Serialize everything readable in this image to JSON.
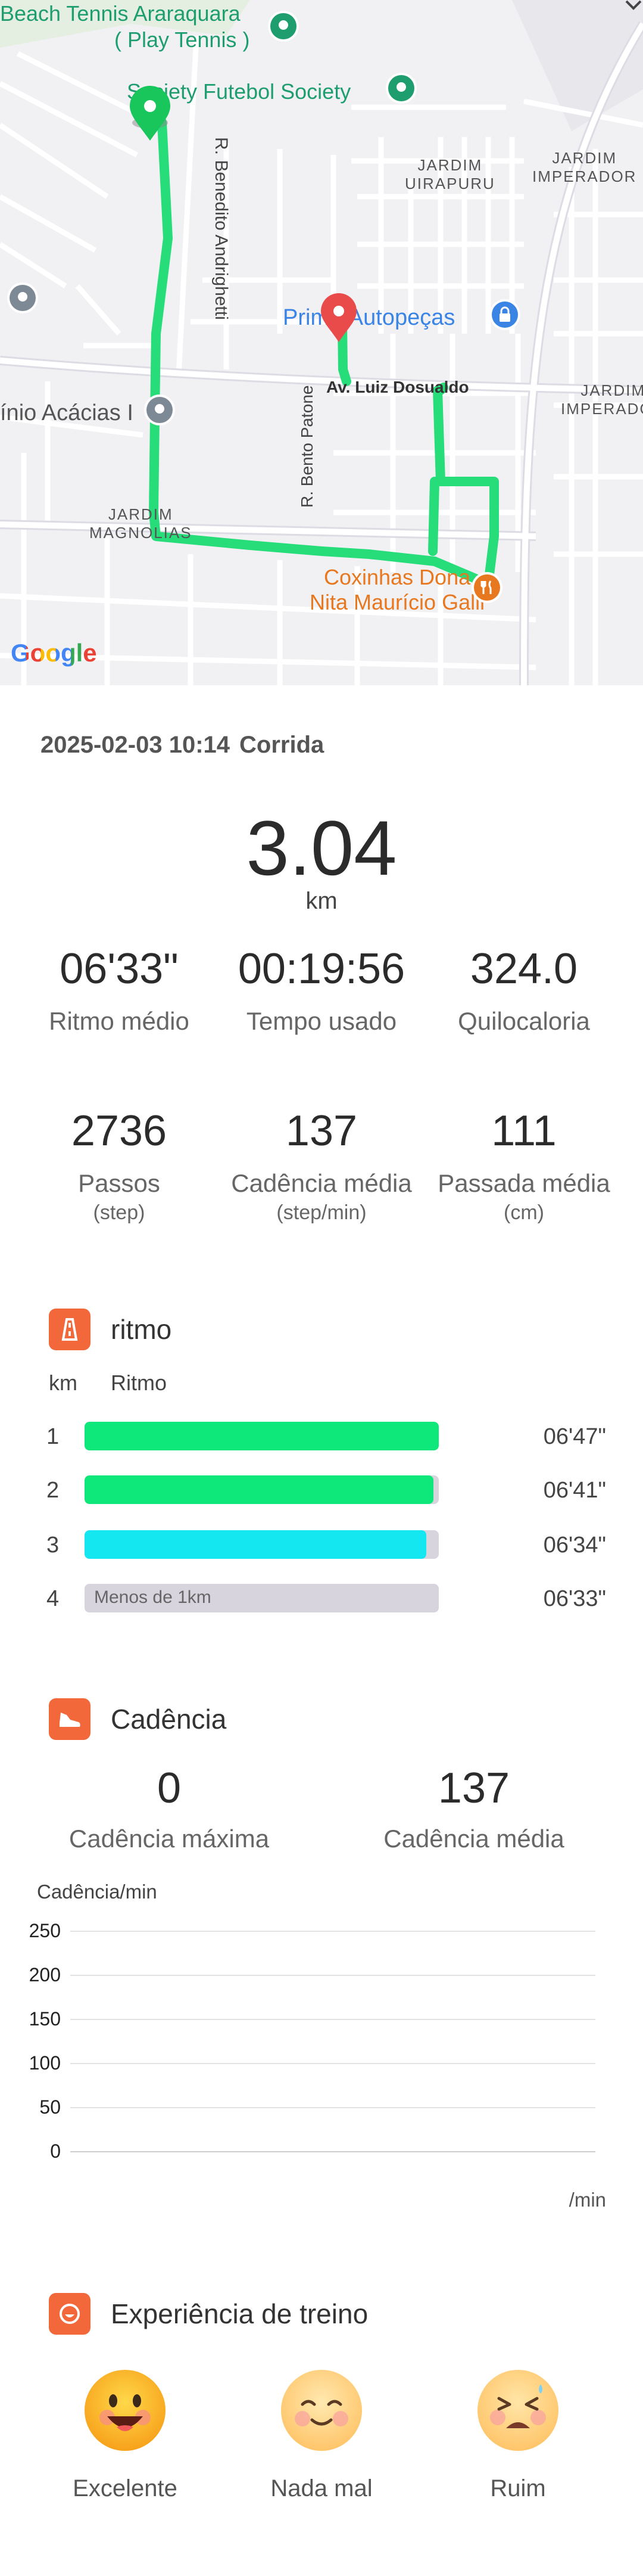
{
  "map": {
    "labels": {
      "beach_tennis_1": "Beach Tennis Araraquara",
      "beach_tennis_2": "( Play Tennis )",
      "soccer": "Society Futebol Society",
      "benedito": "R. Benedito Andrighetti",
      "jardim_uirapuru_1": "JARDIM",
      "jardim_uirapuru_2": "UIRAPURU",
      "jardim_imperador_1": "JARDIM",
      "jardim_imperador_2": "IMPERADOR",
      "jardim_imperador2_1": "JARDIM",
      "jardim_imperador2_2": "IMPERADOR",
      "autopecas": "Prim     - Autopeças",
      "luiz_dosualdo": "Av. Luiz Dosualdo",
      "acacias": "ínio Acácias I",
      "bento_patone": "R. Bento Patone",
      "jardim_magnolias_1": "JARDIM",
      "jardim_magnolias_2": "MAGNOLIAS",
      "coxinhas_1": "Coxinhas Dona",
      "coxinhas_2": "Nita Maurício Galli",
      "google": "Google"
    },
    "colors": {
      "route": "#26dd7a",
      "start_pin": "#19c65c",
      "end_pin": "#e94b4b",
      "poi_green": "#1e9e6e",
      "poi_orange": "#e8781f",
      "poi_blue": "#3a84e6"
    }
  },
  "workout": {
    "date": "2025-02-03 10:14",
    "type": "Corrida",
    "distance": "3.04",
    "distance_unit": "km",
    "stats_row1": [
      {
        "value": "06'33\"",
        "label": "Ritmo médio"
      },
      {
        "value": "00:19:56",
        "label": "Tempo usado"
      },
      {
        "value": "324.0",
        "label": "Quilocaloria"
      }
    ],
    "stats_row2": [
      {
        "value": "2736",
        "label": "Passos",
        "unit": "(step)"
      },
      {
        "value": "137",
        "label": "Cadência média",
        "unit": "(step/min)"
      },
      {
        "value": "111",
        "label": "Passada média",
        "unit": "(cm)"
      }
    ]
  },
  "pace": {
    "title": "ritmo",
    "col_km": "km",
    "col_pace": "Ritmo",
    "rows": [
      {
        "km": "1",
        "pace": "06'47\"",
        "fill": 1.0,
        "color": "#0ee77a",
        "note": ""
      },
      {
        "km": "2",
        "pace": "06'41\"",
        "fill": 0.985,
        "color": "#0ee77a",
        "note": ""
      },
      {
        "km": "3",
        "pace": "06'34\"",
        "fill": 0.965,
        "color": "#14e7ef",
        "note": ""
      },
      {
        "km": "4",
        "pace": "06'33\"",
        "fill": 0.0,
        "color": "#d7d4de",
        "note": "Menos de 1km"
      }
    ]
  },
  "cadence": {
    "title": "Cadência",
    "max_value": "0",
    "max_label": "Cadência máxima",
    "avg_value": "137",
    "avg_label": "Cadência média",
    "chart_title": "Cadência/min",
    "y_ticks": [
      "250",
      "200",
      "150",
      "100",
      "50",
      "0"
    ],
    "x_unit": "/min"
  },
  "chart_data": {
    "type": "line",
    "title": "Cadência/min",
    "xlabel": "/min",
    "ylabel": "",
    "ylim": [
      0,
      250
    ],
    "y_ticks": [
      250,
      200,
      150,
      100,
      50,
      0
    ],
    "series": []
  },
  "experience": {
    "title": "Experiência de treino",
    "options": [
      {
        "label": "Excelente",
        "icon": "grinning-face-icon"
      },
      {
        "label": "Nada mal",
        "icon": "smiling-face-icon"
      },
      {
        "label": "Ruim",
        "icon": "tired-face-icon"
      }
    ]
  }
}
